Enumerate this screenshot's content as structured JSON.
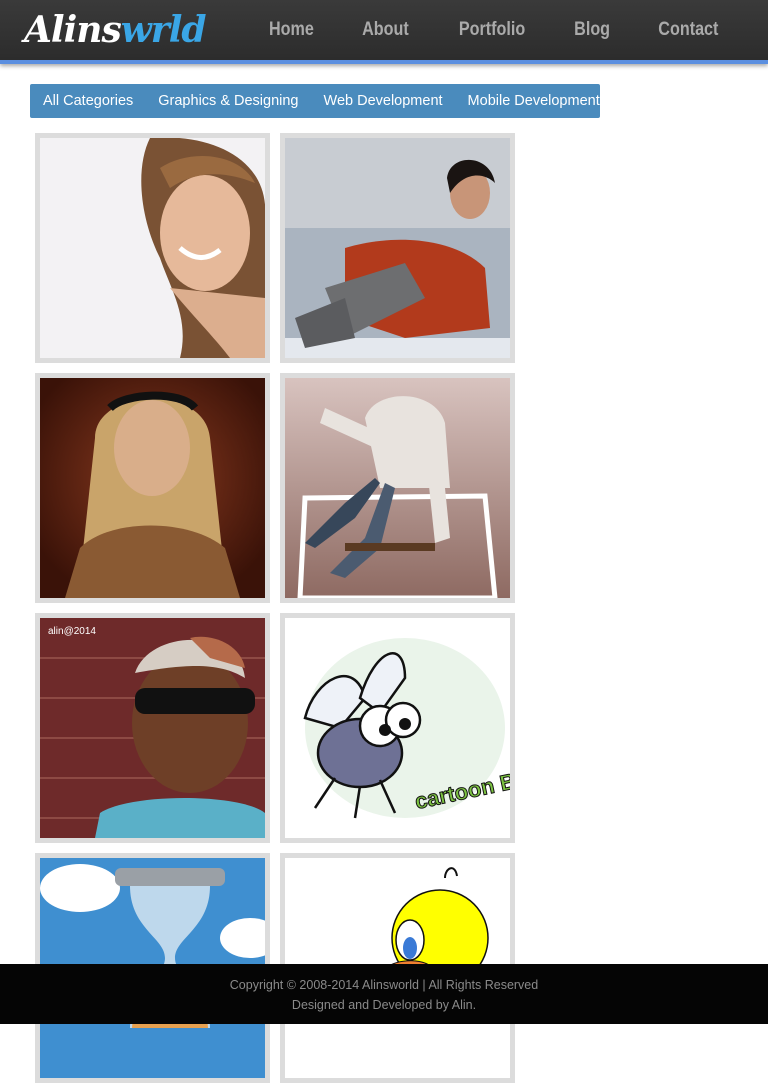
{
  "brand": {
    "logo_part1": "Alins",
    "logo_part2": "w",
    "logo_part3": "rld",
    "logo_accent": "#3aa6e6"
  },
  "nav": [
    "Home",
    "About",
    "Portfolio",
    "Blog",
    "Contact"
  ],
  "categories": [
    "All Categories",
    "Graphics & Designing",
    "Web Development",
    "Mobile Development"
  ],
  "gallery": [
    {
      "subject": "smiling-woman-portrait"
    },
    {
      "subject": "woman-on-sofa"
    },
    {
      "subject": "blonde-woman-portrait"
    },
    {
      "subject": "man-in-hoodie-jumping"
    },
    {
      "subject": "man-broken-head-manipulation",
      "watermark": "alin@2014"
    },
    {
      "subject": "cartoon-bug",
      "artwork_text": "cartoon BUG"
    },
    {
      "subject": "hourglass-clouds"
    },
    {
      "subject": "tweety-bird"
    }
  ],
  "footer": {
    "copyright": "Copyright © 2008-2014 Alinsworld | All Rights Reserved",
    "credit": "Designed and Developed by Alin."
  },
  "colors": {
    "header_bg": "#2f2f2f",
    "header_border": "#5b8fe0",
    "catbar_bg": "#4a8bbd",
    "footer_bg": "#050505"
  }
}
